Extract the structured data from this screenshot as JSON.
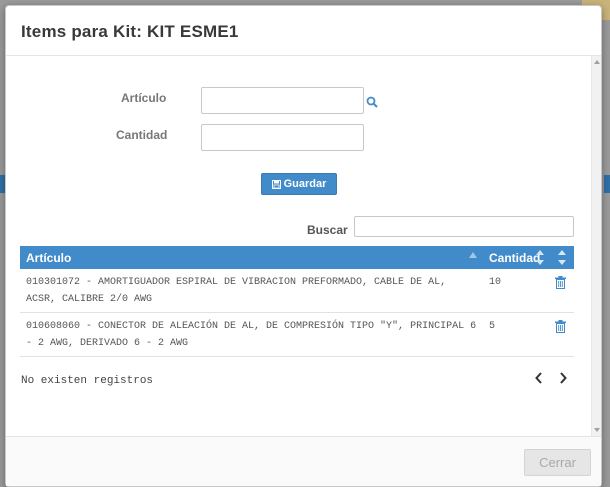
{
  "modal": {
    "title": "Items para Kit: KIT ESME1"
  },
  "form": {
    "articulo_label": "Artículo",
    "articulo_value": "",
    "cantidad_label": "Cantidad",
    "cantidad_value": "",
    "save_label": "Guardar"
  },
  "search": {
    "label": "Buscar",
    "value": ""
  },
  "table": {
    "headers": [
      "Artículo",
      "Cantidad"
    ],
    "rows": [
      {
        "articulo": "010301072 - AMORTIGUADOR ESPIRAL DE VIBRACION PREFORMADO, CABLE DE AL, ACSR, CALIBRE 2/0 AWG",
        "cantidad": "10"
      },
      {
        "articulo": "010608060 - CONECTOR DE ALEACIÓN DE AL, DE COMPRESIÓN TIPO \"Y\", PRINCIPAL 6 - 2 AWG, DERIVADO 6 - 2 AWG",
        "cantidad": "5"
      }
    ]
  },
  "info": {
    "text": "No existen registros"
  },
  "footer": {
    "close_label": "Cerrar"
  },
  "colors": {
    "accent": "#428bca",
    "title": "#393939",
    "label": "#777777"
  }
}
